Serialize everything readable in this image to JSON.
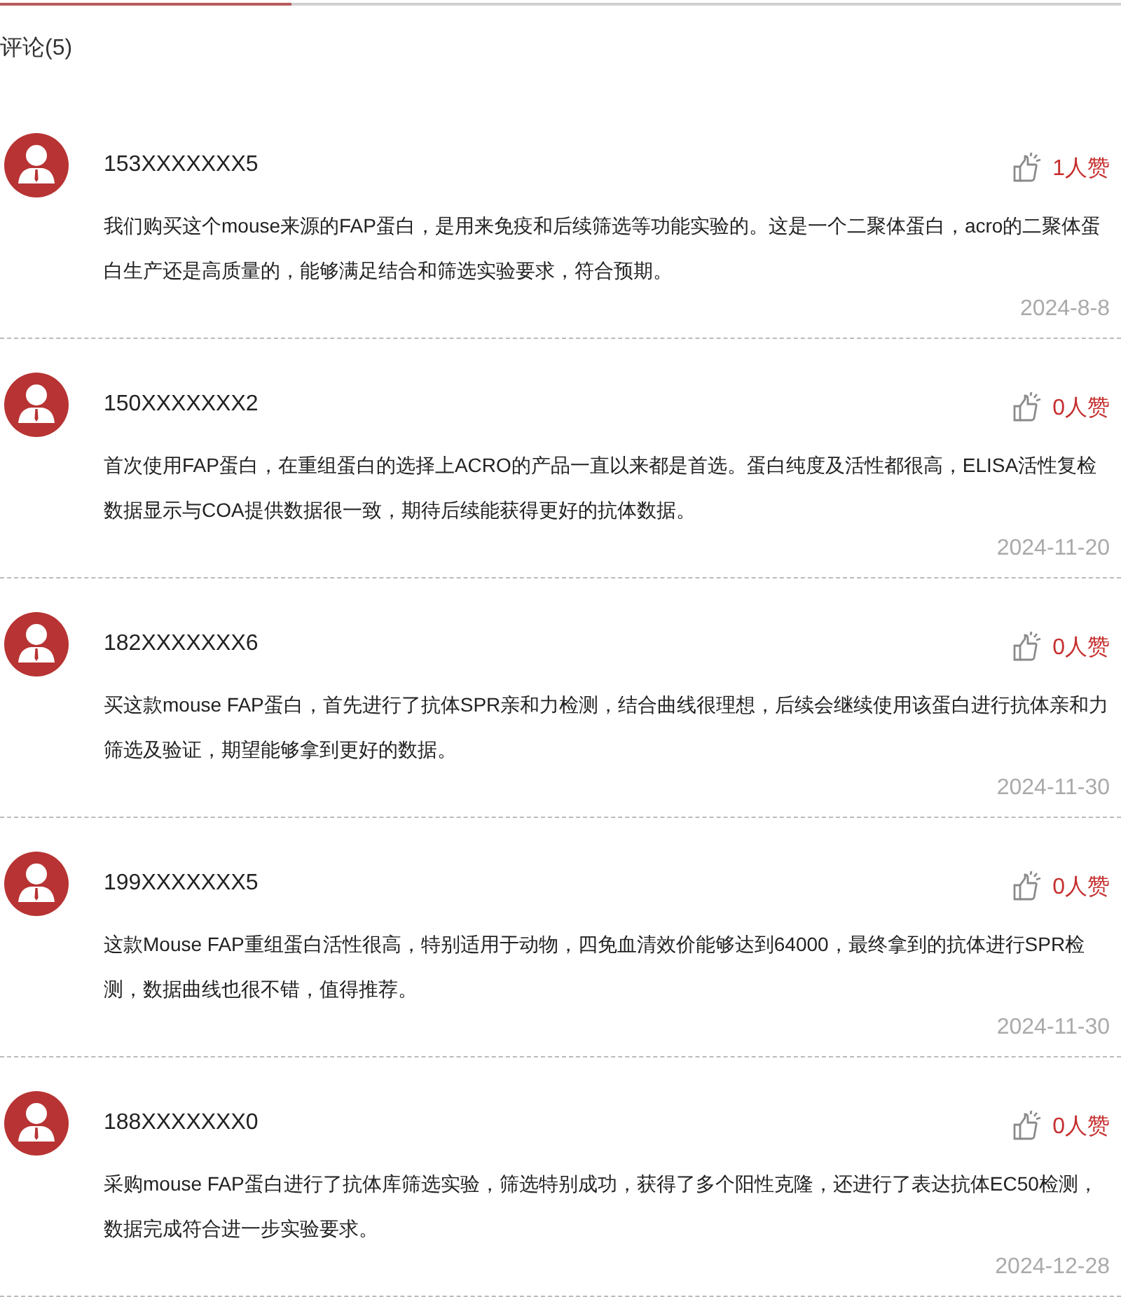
{
  "title": "评论(5)",
  "comments": [
    {
      "user": "153XXXXXXX5",
      "likes": "1人赞",
      "text": "我们购买这个mouse来源的FAP蛋白，是用来免疫和后续筛选等功能实验的。这是一个二聚体蛋白，acro的二聚体蛋白生产还是高质量的，能够满足结合和筛选实验要求，符合预期。",
      "date": "2024-8-8"
    },
    {
      "user": "150XXXXXXX2",
      "likes": "0人赞",
      "text": "首次使用FAP蛋白，在重组蛋白的选择上ACRO的产品一直以来都是首选。蛋白纯度及活性都很高，ELISA活性复检数据显示与COA提供数据很一致，期待后续能获得更好的抗体数据。",
      "date": "2024-11-20"
    },
    {
      "user": "182XXXXXXX6",
      "likes": "0人赞",
      "text": "买这款mouse FAP蛋白，首先进行了抗体SPR亲和力检测，结合曲线很理想，后续会继续使用该蛋白进行抗体亲和力筛选及验证，期望能够拿到更好的数据。",
      "date": "2024-11-30"
    },
    {
      "user": "199XXXXXXX5",
      "likes": "0人赞",
      "text": "这款Mouse FAP重组蛋白活性很高，特别适用于动物，四免血清效价能够达到64000，最终拿到的抗体进行SPR检测，数据曲线也很不错，值得推荐。",
      "date": "2024-11-30"
    },
    {
      "user": "188XXXXXXX0",
      "likes": "0人赞",
      "text": "采购mouse FAP蛋白进行了抗体库筛选实验，筛选特别成功，获得了多个阳性克隆，还进行了表达抗体EC50检测，数据完成符合进一步实验要求。",
      "date": "2024-12-28"
    }
  ]
}
